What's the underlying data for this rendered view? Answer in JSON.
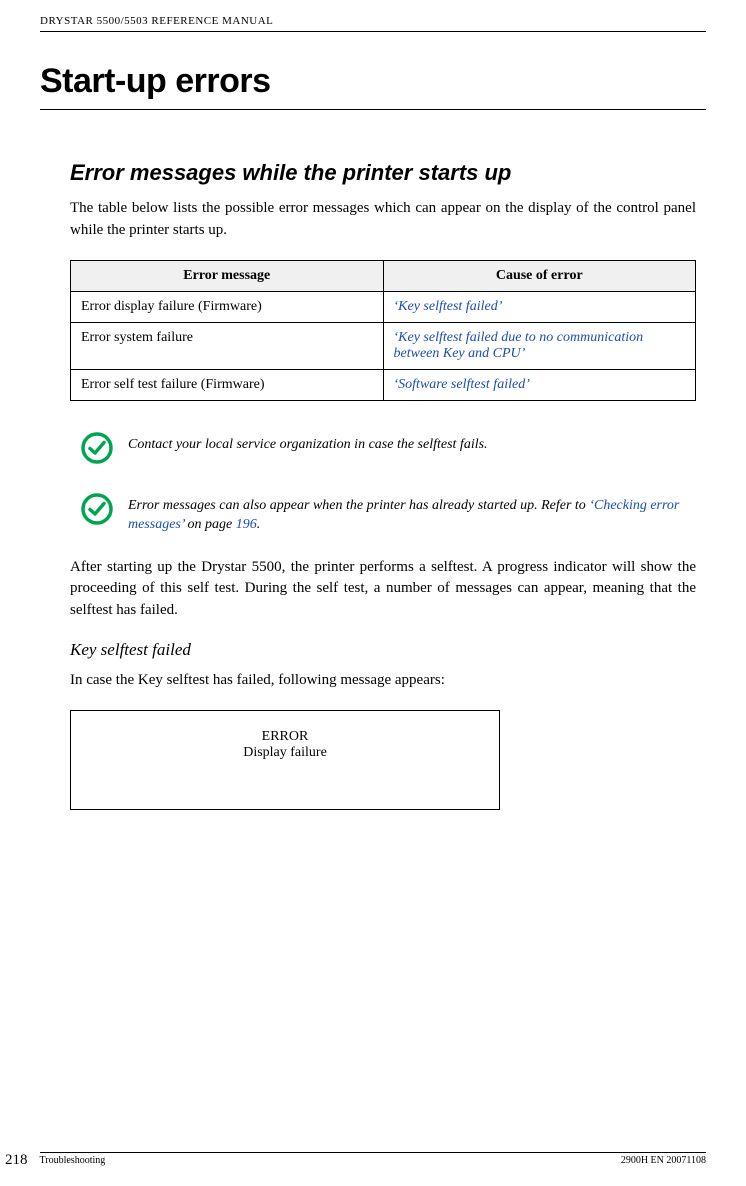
{
  "header": {
    "doc_title": "DRYSTAR 5500/5503 REFERENCE MANUAL"
  },
  "main_title": "Start-up errors",
  "section_title": "Error messages while the printer starts up",
  "intro_text": "The table below lists the possible error messages which can appear on the display of the control panel while the printer starts up.",
  "table": {
    "headers": {
      "col1": "Error message",
      "col2": "Cause of error"
    },
    "rows": [
      {
        "msg": "Error display failure (Firmware)",
        "cause": "‘Key selftest failed’"
      },
      {
        "msg": "Error system failure",
        "cause": "‘Key selftest failed due to no communication between Key and CPU’"
      },
      {
        "msg": "Error self test failure (Firmware)",
        "cause": "‘Software selftest failed’"
      }
    ]
  },
  "note1": "Contact your local service organization in case the selftest fails.",
  "note2_prefix": "Error messages can also appear when the printer has already started up. Refer to ",
  "note2_link": "‘Checking error messages’",
  "note2_middle": " on page ",
  "note2_page": "196",
  "note2_suffix": ".",
  "after_text": "After starting up the Drystar 5500, the printer performs a selftest. A progress indicator will show the proceeding of this self test. During the self test, a number of messages can appear, meaning that the selftest has failed.",
  "sub_heading": "Key selftest failed",
  "sub_text": "In case the Key selftest has failed, following message appears:",
  "display_box": {
    "line1": "ERROR",
    "line2": "Display failure"
  },
  "footer": {
    "page_num": "218",
    "left": "Troubleshooting",
    "right": "2900H EN 20071108"
  }
}
